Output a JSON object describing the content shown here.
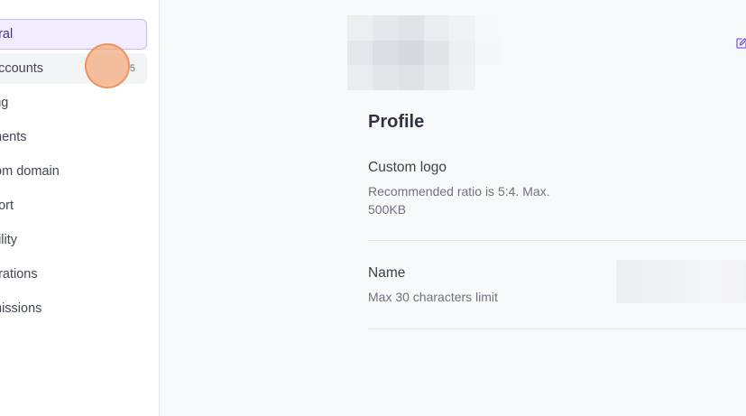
{
  "sidebar": {
    "items": [
      {
        "label": "eral",
        "active": true
      },
      {
        "label": "accounts",
        "badge": "5",
        "hover": true
      },
      {
        "label": "ing"
      },
      {
        "label": "ments"
      },
      {
        "label": "tom domain"
      },
      {
        "label": "port"
      },
      {
        "label": "bility"
      },
      {
        "label": "grations"
      },
      {
        "label": "missions"
      }
    ]
  },
  "main": {
    "section_title": "Profile",
    "edit_icon": "edit-icon",
    "fields": [
      {
        "label": "Custom logo",
        "help": "Recommended ratio is 5:4. Max. 500KB"
      },
      {
        "label": "Name",
        "help": "Max 30 characters limit"
      }
    ]
  },
  "colors": {
    "accent": "#7c5cd6",
    "active_bg": "#f1ecfe",
    "click_marker": "#f4a878"
  }
}
